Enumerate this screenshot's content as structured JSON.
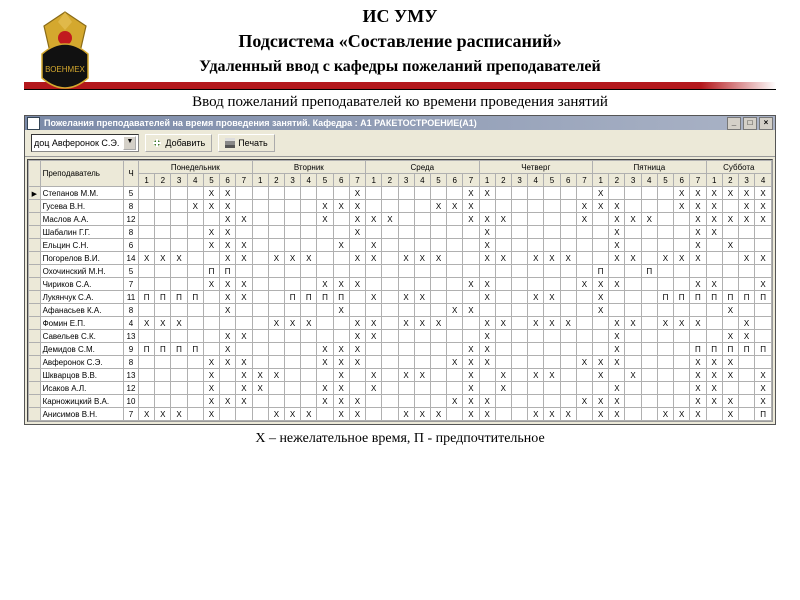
{
  "heading1": "ИС УМУ",
  "heading2": "Подсистема «Составление расписаний»",
  "heading3": "Удаленный ввод с кафедры пожеланий преподавателей",
  "caption": "Ввод пожеланий преподавателей ко времени проведения занятий",
  "window_title": "Пожелания преподавателей на время проведения занятий. Кафедра : А1 РАКЕТОСТРОЕНИЕ(А1)",
  "combo_value": "доц Авферонок С.Э.",
  "btn_add": "Добавить",
  "btn_print": "Печать",
  "days": [
    "Понедельник",
    "Вторник",
    "Среда",
    "Четверг",
    "Пятница",
    "Суббота"
  ],
  "day_slots": [
    7,
    7,
    7,
    7,
    7,
    4
  ],
  "col_teacher": "Преподаватель",
  "col_hours": "Ч",
  "rows": [
    {
      "name": "Степанов М.М.",
      "ch": 5,
      "cells": "    XX       X      XX      X    XXXXXXX "
    },
    {
      "name": "Гусева В.Н.",
      "ch": 8,
      "cells": "   XXX     XXX    XXX      XXX   XXX XXX "
    },
    {
      "name": "Маслов А.А.",
      "ch": 12,
      "cells": "     XX    X XXX    XXX    X XXX  XXXXXXX"
    },
    {
      "name": "Шабалин Г.Г.",
      "ch": 8,
      "cells": "    XX       X       X       X    XX     "
    },
    {
      "name": "Ельцин С.Н.",
      "ch": 6,
      "cells": "    XXX     X X      X       X    X X    "
    },
    {
      "name": "Погорелов В.И.",
      "ch": 14,
      "cells": "XXX  XX XXX  XX XXX  XX XXX  XX XXX  XXXXX"
    },
    {
      "name": "Охочинский М.Н.",
      "ch": 5,
      "cells": "    ПП                      П  П          "
    },
    {
      "name": "Чириков С.А.",
      "ch": 7,
      "cells": "    XXX    XXX      XX     XXX    XX  XXX"
    },
    {
      "name": "Лукянчук С.А.",
      "ch": 11,
      "cells": "ПППП XX  ПППП X XX   X  XX  X   ПППППППП "
    },
    {
      "name": "Афанасьев К.А.",
      "ch": 8,
      "cells": "     X      X      XX       X       X    "
    },
    {
      "name": "Фомин Е.П.",
      "ch": 4,
      "cells": "XXX     XXX  XX XXX  XX XXX  XX XXX  X ППП"
    },
    {
      "name": "Савельев С.К.",
      "ch": 13,
      "cells": "     XX      XX      X       X      XX   "
    },
    {
      "name": "Демидов С.М.",
      "ch": 9,
      "cells": "ПППП X     XXX      XX       X    ПППППП "
    },
    {
      "name": "Авферонок С.Э.",
      "ch": 8,
      "cells": "    XXX    XXX     XXX     XXX    XXX    "
    },
    {
      "name": "Шкварцов В.В.",
      "ch": 13,
      "cells": "    X XXX   X X XX  X X XX  X X   XXX XXX"
    },
    {
      "name": "Исаков А.Л.",
      "ch": 12,
      "cells": "    X XX   XX X     X X      X    XX  XXX"
    },
    {
      "name": "Карножицкий В.А.",
      "ch": 10,
      "cells": "    XXX    XXX     XXX     XXX    XXX XXX"
    },
    {
      "name": "Анисимов В.Н.",
      "ch": 7,
      "cells": "XXX X   XXX XX  XXX XX  XXX XX  XXX X ППП"
    }
  ],
  "legend": "Х – нежелательное время, П - предпочтительное"
}
